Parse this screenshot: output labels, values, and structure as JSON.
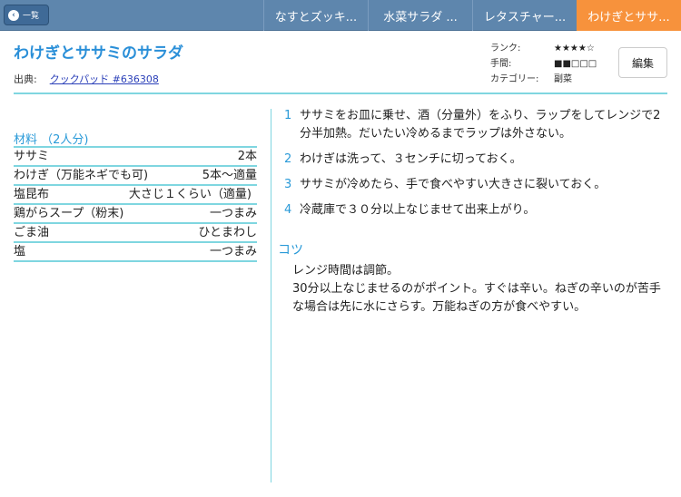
{
  "nav": {
    "back_label": "一覧",
    "tabs": [
      "なすとズッキ...",
      "水菜サラダ ...",
      "レタスチャー...",
      "わけぎとササ..."
    ],
    "active_tab": 3
  },
  "recipe": {
    "title": "わけぎとササミのサラダ",
    "source_label": "出典:",
    "source_link": "クックパッド #636308",
    "meta": [
      {
        "k": "ランク:",
        "v": "★★★★☆"
      },
      {
        "k": "手間:",
        "v": "■■□□□"
      },
      {
        "k": "カテゴリー:",
        "v": "副菜"
      }
    ],
    "edit_label": "編集"
  },
  "ingredients": {
    "heading": "材料 （2人分)",
    "items": [
      {
        "name": "ササミ",
        "qty": "2本"
      },
      {
        "name": "わけぎ（万能ネギでも可)",
        "qty": "5本〜適量"
      },
      {
        "name": "塩昆布",
        "qty": "大さじ１くらい（適量)"
      },
      {
        "name": "鶏がらスープ（粉末)",
        "qty": "一つまみ"
      },
      {
        "name": "ごま油",
        "qty": "ひとまわし"
      },
      {
        "name": "塩",
        "qty": "一つまみ"
      }
    ]
  },
  "steps": [
    {
      "n": "1",
      "text": "ササミをお皿に乗せ、酒（分量外）をふり、ラップをしてレンジで2分半加熱。だいたい冷めるまでラップは外さない。"
    },
    {
      "n": "2",
      "text": "わけぎは洗って、３センチに切っておく。"
    },
    {
      "n": "3",
      "text": "ササミが冷めたら、手で食べやすい大きさに裂いておく。"
    },
    {
      "n": "4",
      "text": "冷蔵庫で３０分以上なじませて出来上がり。"
    }
  ],
  "tips": {
    "heading": "コツ",
    "lines": [
      "レンジ時間は調節。",
      "30分以上なじませるのがポイント。すぐは辛い。ねぎの辛いのが苦手な場合は先に水にさらす。万能ねぎの方が食べやすい。"
    ]
  },
  "colors": {
    "accent": "#2a9ad8",
    "active_tab": "#f7923c",
    "bar": "#5e86ad"
  }
}
